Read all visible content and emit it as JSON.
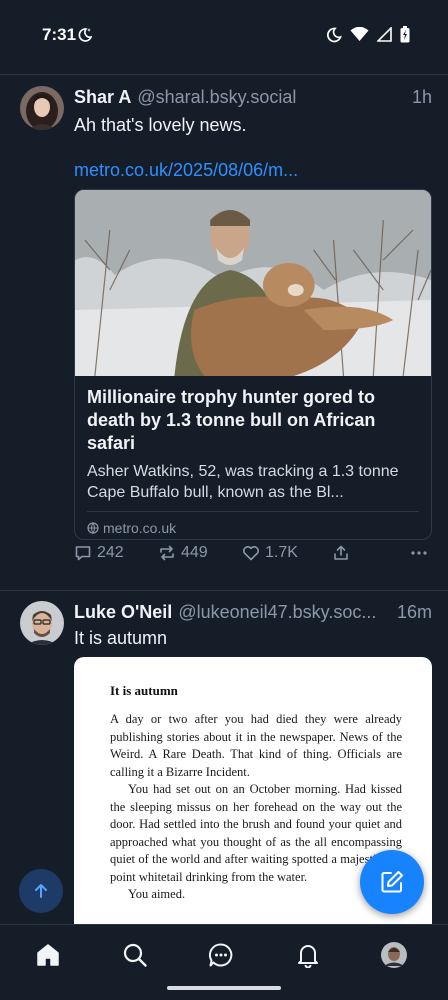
{
  "status": {
    "time": "7:31"
  },
  "posts": [
    {
      "display_name": "Shar A",
      "handle": "@sharal.bsky.social",
      "time": "1h",
      "text": "Ah that's lovely news.",
      "link": "metro.co.uk/2025/08/06/m...",
      "embed": {
        "title": "Millionaire trophy hunter gored to death by 1.3 tonne bull on African safari",
        "description": "Asher Watkins, 52, was tracking a 1.3 tonne Cape Buffalo bull, known as the Bl...",
        "domain": "metro.co.uk"
      },
      "replies": "242",
      "reposts": "449",
      "likes": "1.7K"
    },
    {
      "display_name": "Luke O'Neil",
      "handle": "@lukeoneil47.bsky.soc...",
      "time": "16m",
      "text": "It is autumn",
      "image_text": {
        "title": "It is autumn",
        "paragraphs": [
          "A day or two after you had died they were already publishing stories about it in the newspaper. News of the Weird. A Rare Death. That kind of thing. Officials are calling it a Bizarre Incident.",
          "You had set out on an October morning. Had kissed the sleeping missus on her forehead on the way out the door. Had settled into the brush and found your quiet and approached what you thought of as the all encompassing quiet of the world and after waiting spotted a majestic 10-point whitetail drinking from the water.",
          "You aimed."
        ]
      }
    }
  ],
  "nav": [
    "home",
    "search",
    "chat",
    "notifications",
    "profile"
  ]
}
